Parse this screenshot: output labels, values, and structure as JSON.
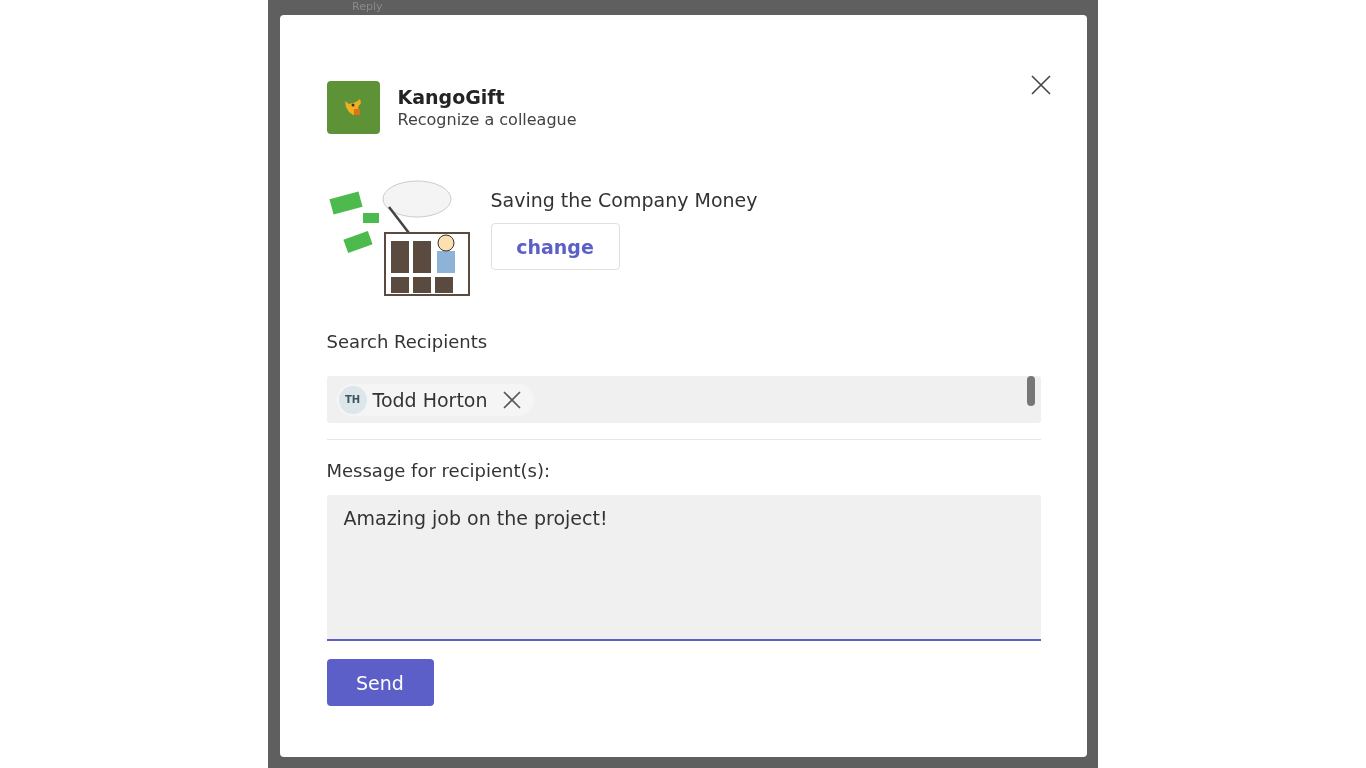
{
  "background": {
    "reply_label": "Reply"
  },
  "dialog": {
    "app_name": "KangoGift",
    "subtitle": "Recognize a colleague",
    "award": {
      "title": "Saving the Company Money",
      "change_button": "change"
    },
    "recipients_label": "Search Recipients",
    "recipients": [
      {
        "initials": "TH",
        "name": "Todd Horton"
      }
    ],
    "message_label": "Message for recipient(s):",
    "message": {
      "value": "Amazing job on the project!"
    },
    "send_button": "Send"
  }
}
